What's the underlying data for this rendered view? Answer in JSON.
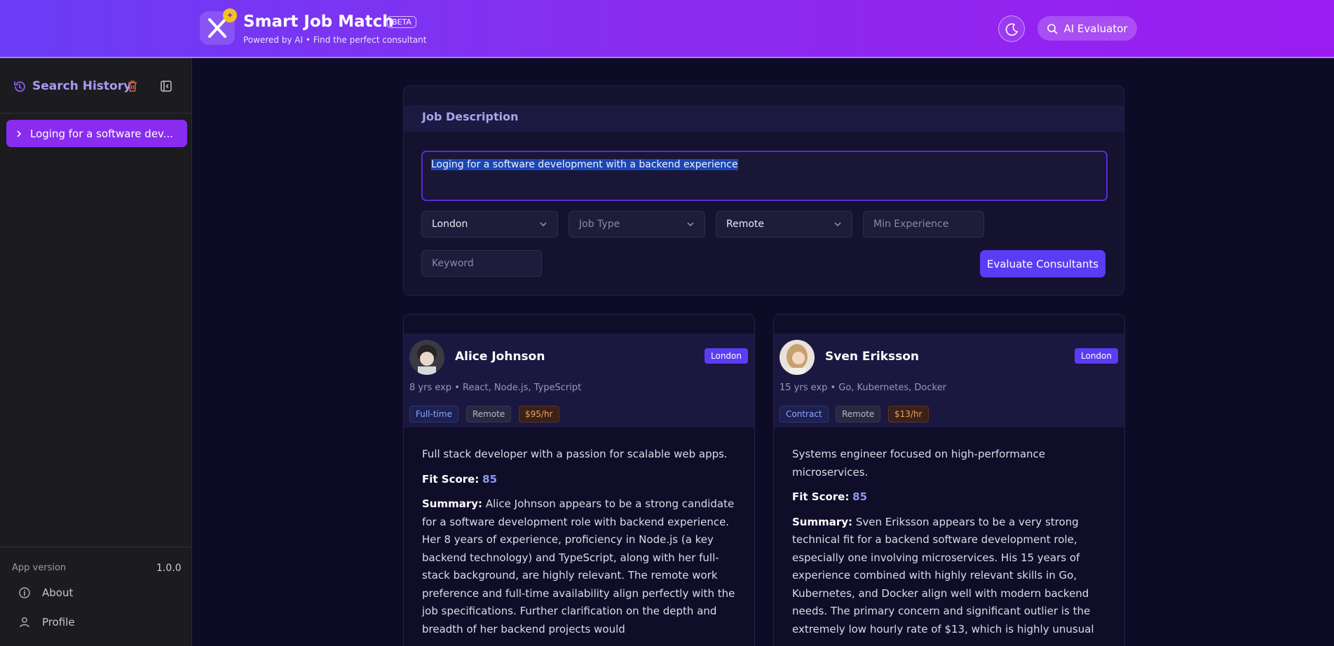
{
  "header": {
    "title": "Smart Job Match",
    "beta": "BETA",
    "subtitle": "Powered by AI • Find the perfect consultant",
    "ai_button": "AI Evaluator"
  },
  "sidebar": {
    "title": "Search History",
    "items": [
      {
        "label": "Loging for a software dev..."
      }
    ],
    "version_label": "App version",
    "version_value": "1.0.0",
    "links": [
      {
        "label": "About"
      },
      {
        "label": "Profile"
      }
    ]
  },
  "job": {
    "title": "Job Description",
    "description": "Loging for a software development with a backend experience",
    "location": "London",
    "job_type_placeholder": "Job Type",
    "work_mode": "Remote",
    "min_exp_placeholder": "Min Experience",
    "keyword_placeholder": "Keyword",
    "evaluate_label": "Evaluate Consultants"
  },
  "consultants": [
    {
      "name": "Alice Johnson",
      "location": "London",
      "meta": "8 yrs exp • React, Node.js, TypeScript",
      "job_type": "Full-time",
      "work_mode": "Remote",
      "rate": "$95/hr",
      "bio": "Full stack developer with a passion for scalable web apps.",
      "fit_label": "Fit Score:",
      "fit_score": "85",
      "summary_label": "Summary:",
      "summary": "Alice Johnson appears to be a strong candidate for a software development role with backend experience. Her 8 years of experience, proficiency in Node.js (a key backend technology) and TypeScript, along with her full-stack background, are highly relevant. The remote work preference and full-time availability align perfectly with the job specifications. Further clarification on the depth and breadth of her backend projects would"
    },
    {
      "name": "Sven Eriksson",
      "location": "London",
      "meta": "15 yrs exp • Go, Kubernetes, Docker",
      "job_type": "Contract",
      "work_mode": "Remote",
      "rate": "$13/hr",
      "bio": "Systems engineer focused on high-performance microservices.",
      "fit_label": "Fit Score:",
      "fit_score": "85",
      "summary_label": "Summary:",
      "summary": "Sven Eriksson appears to be a very strong technical fit for a backend software development role, especially one involving microservices. His 15 years of experience combined with highly relevant skills in Go, Kubernetes, and Docker align well with modern backend needs. The primary concern and significant outlier is the extremely low hourly rate of $13, which is highly unusual"
    }
  ],
  "colors": {
    "accent": "#5b3cf5",
    "header_start": "#6a3cf5",
    "header_end": "#9a1cf0",
    "sidebar_active": "#8a2cf0"
  }
}
